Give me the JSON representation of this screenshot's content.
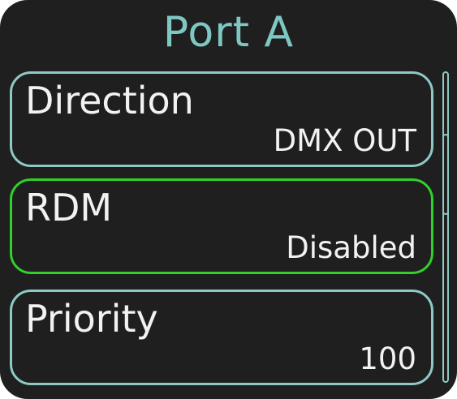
{
  "screen": {
    "title": "Port A"
  },
  "menu": {
    "items": [
      {
        "label": "Direction",
        "value": "DMX OUT",
        "selected": false
      },
      {
        "label": "RDM",
        "value": "Disabled",
        "selected": true
      },
      {
        "label": "Priority",
        "value": "100",
        "selected": false
      }
    ]
  },
  "scrollbar": {
    "position_fraction": 0.27
  },
  "colors": {
    "background": "#1f1f1f",
    "title": "#7fc7c2",
    "border": "#8ec9c6",
    "selected_border": "#2fd12a",
    "text": "#f2f2f2"
  }
}
